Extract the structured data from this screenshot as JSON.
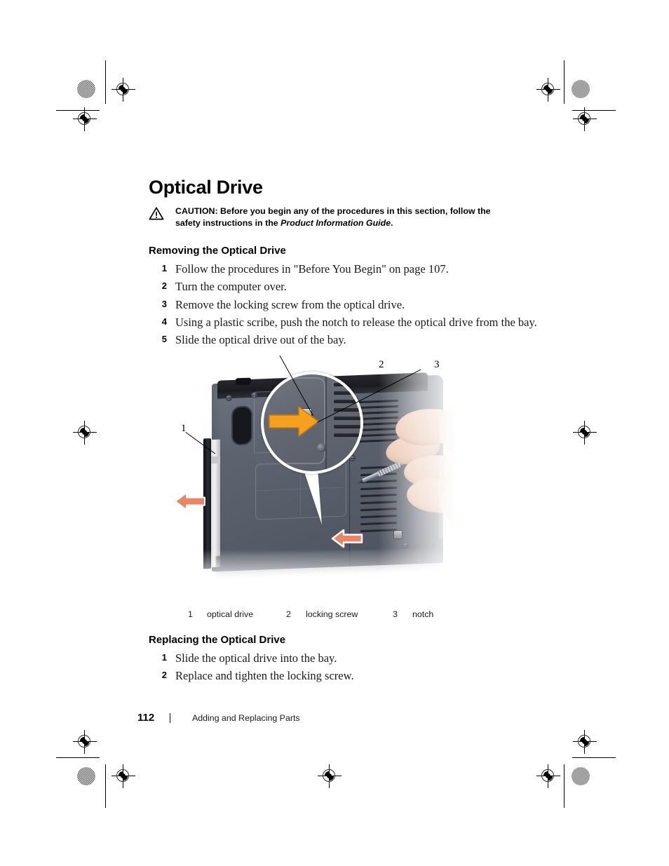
{
  "page": {
    "title": "Optical Drive",
    "caution": {
      "label": "CAUTION:",
      "text_before": " Before you begin any of the procedures in this section, follow the safety instructions in the ",
      "italic_ref": "Product Information Guide",
      "text_after": "."
    },
    "sections": [
      {
        "heading": "Removing the Optical Drive",
        "steps": [
          {
            "num": "1",
            "text": "Follow the procedures in \"Before You Begin\" on page 107."
          },
          {
            "num": "2",
            "text": "Turn the computer over."
          },
          {
            "num": "3",
            "text": "Remove the locking screw from the optical drive."
          },
          {
            "num": "4",
            "text": "Using a plastic scribe, push the notch to release the optical drive from the bay."
          },
          {
            "num": "5",
            "text": "Slide the optical drive out of the bay."
          }
        ]
      },
      {
        "heading": "Replacing the Optical Drive",
        "steps": [
          {
            "num": "1",
            "text": "Slide the optical drive into the bay."
          },
          {
            "num": "2",
            "text": "Replace and tighten the locking screw."
          }
        ]
      }
    ],
    "figure": {
      "callouts": [
        {
          "num": "1",
          "label": "optical drive"
        },
        {
          "num": "2",
          "label": "locking screw"
        },
        {
          "num": "3",
          "label": "notch"
        }
      ]
    },
    "footer": {
      "page_number": "112",
      "separator": "|",
      "section_title": "Adding and Replacing Parts"
    },
    "colors": {
      "text": "#000000",
      "body_text": "#1a1a1a",
      "arrow_bright": "#f5a01e",
      "arrow_soft": "#e8866a",
      "laptop_body": "#5d636f",
      "laptop_edge": "#1a1c21",
      "skin": "#e9c2ab"
    }
  }
}
